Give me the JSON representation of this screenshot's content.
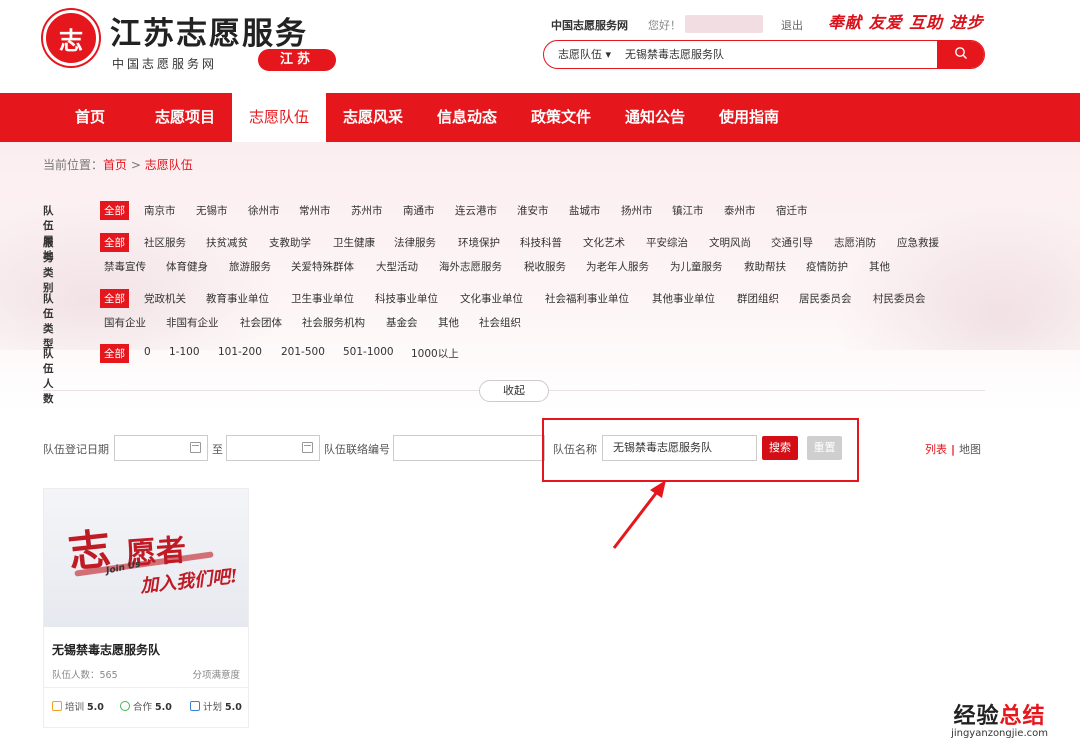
{
  "header": {
    "logo_text": "志",
    "site_title": "江苏志愿服务",
    "site_subtitle": "中国志愿服务网",
    "province": "江苏",
    "top_links": {
      "network": "中国志愿服务网",
      "greeting": "您好！",
      "logout": "退出"
    },
    "slogan": "奉献 友爱 互助 进步",
    "search": {
      "category": "志愿队伍 ▾",
      "value": "无锡禁毒志愿服务队",
      "button_icon": "search-icon"
    }
  },
  "nav": [
    "首页",
    "志愿项目",
    "志愿队伍",
    "志愿风采",
    "信息动态",
    "政策文件",
    "通知公告",
    "使用指南"
  ],
  "nav_active": "志愿队伍",
  "breadcrumb": {
    "prefix": "当前位置：",
    "home": "首页",
    "sep": ">",
    "current": "志愿队伍"
  },
  "filters": {
    "region": {
      "label": "队伍属地",
      "options": [
        "全部",
        "南京市",
        "无锡市",
        "徐州市",
        "常州市",
        "苏州市",
        "南通市",
        "连云港市",
        "淮安市",
        "盐城市",
        "扬州市",
        "镇江市",
        "泰州市",
        "宿迁市"
      ]
    },
    "service": {
      "label": "服务类别",
      "row1": [
        "全部",
        "社区服务",
        "扶贫减贫",
        "支教助学",
        "卫生健康",
        "法律服务",
        "环境保护",
        "科技科普",
        "文化艺术",
        "平安综治",
        "文明风尚",
        "交通引导",
        "志愿消防",
        "应急救援"
      ],
      "row2": [
        "禁毒宣传",
        "体育健身",
        "旅游服务",
        "关爱特殊群体",
        "大型活动",
        "海外志愿服务",
        "税收服务",
        "为老年人服务",
        "为儿童服务",
        "救助帮扶",
        "疫情防护",
        "其他"
      ]
    },
    "type": {
      "label": "队伍类型",
      "row1": [
        "全部",
        "党政机关",
        "教育事业单位",
        "卫生事业单位",
        "科技事业单位",
        "文化事业单位",
        "社会福利事业单位",
        "其他事业单位",
        "群团组织",
        "居民委员会",
        "村民委员会"
      ],
      "row2": [
        "国有企业",
        "非国有企业",
        "社会团体",
        "社会服务机构",
        "基金会",
        "其他",
        "社会组织"
      ]
    },
    "size": {
      "label": "队伍人数",
      "options": [
        "全部",
        "0",
        "1-100",
        "101-200",
        "201-500",
        "501-1000",
        "1000以上"
      ]
    }
  },
  "collapse_label": "收起",
  "form": {
    "date_label": "队伍登记日期",
    "date_sep": "至",
    "contact_label": "队伍联络编号",
    "name_label": "队伍名称",
    "name_value": "无锡禁毒志愿服务队",
    "search_btn": "搜索",
    "reset_btn": "重置",
    "view_list": "列表",
    "view_sep": "|",
    "view_map": "地图"
  },
  "card": {
    "img_text1": "志",
    "img_text2": "愿者",
    "img_join": "Join Us",
    "img_text3": "加入我们吧!",
    "title": "无锡禁毒志愿服务队",
    "count": "队伍人数：565",
    "tag": "分项满意度",
    "metrics": [
      {
        "label": "培训",
        "value": "5.0",
        "color": "#f0a020"
      },
      {
        "label": "合作",
        "value": "5.0",
        "color": "#3cba54"
      },
      {
        "label": "计划",
        "value": "5.0",
        "color": "#3b82d6"
      }
    ]
  },
  "watermark": {
    "line1_a": "经验",
    "line1_b": "总结",
    "line2": "jingyanzongjie.com"
  }
}
